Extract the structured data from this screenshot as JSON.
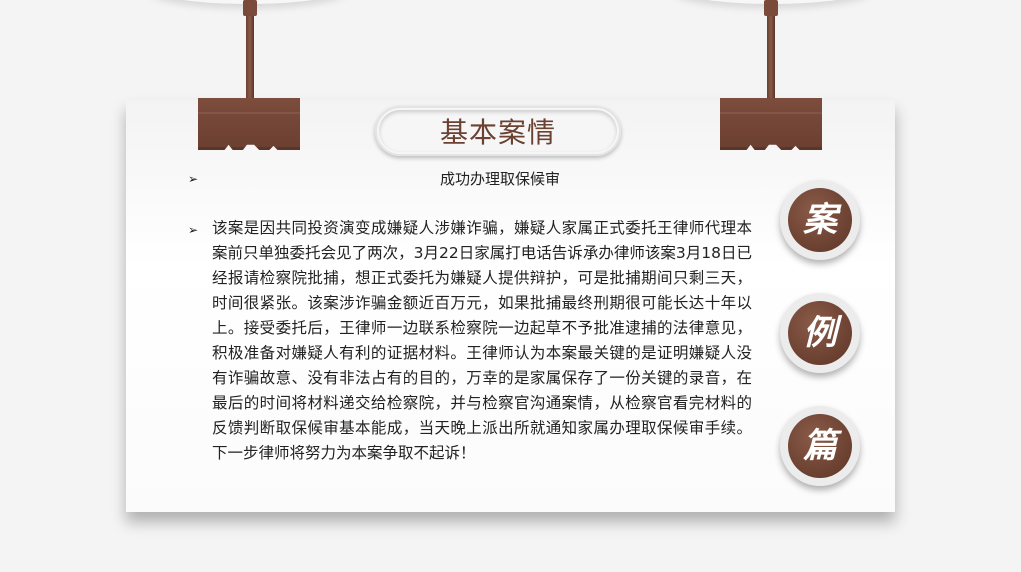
{
  "title": "基本案情",
  "subtitle": "成功办理取保候审",
  "bullet_marker": "➢",
  "body": "该案是因共同投资演变成嫌疑人涉嫌诈骗，嫌疑人家属正式委托王律师代理本案前只单独委托会见了两次，3月22日家属打电话告诉承办律师该案3月18日已经报请检察院批捕，想正式委托为嫌疑人提供辩护，可是批捕期间只剩三天，时间很紧张。该案涉诈骗金额近百万元，如果批捕最终刑期很可能长达十年以上。接受委托后，王律师一边联系检察院一边起草不予批准逮捕的法律意见，积极准备对嫌疑人有利的证据材料。王律师认为本案最关键的是证明嫌疑人没有诈骗故意、没有非法占有的目的，万幸的是家属保存了一份关键的录音，在最后的时间将材料递交给检察院，并与检察官沟通案情，从检察官看完材料的反馈判断取保候审基本能成，当天晚上派出所就通知家属办理取保候审手续。下一步律师将努力为本案争取不起诉！",
  "seals": [
    "案",
    "例",
    "篇"
  ],
  "colors": {
    "brown": "#6b4131",
    "background": "#f4f4f4",
    "card": "#ffffff"
  }
}
